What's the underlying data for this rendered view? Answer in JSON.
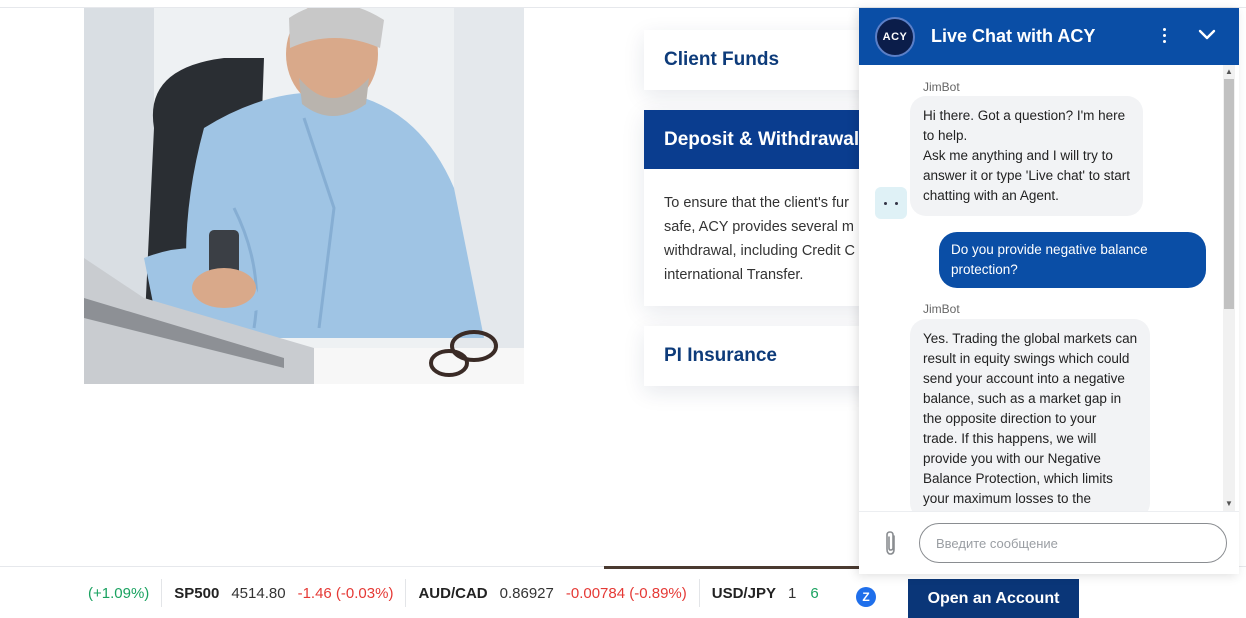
{
  "accordion": {
    "items": [
      {
        "title": "Client Funds"
      },
      {
        "title": "Deposit & Withdrawal",
        "body_lines": [
          "To ensure that the client's fur",
          "safe, ACY provides several m",
          "withdrawal, including Credit C",
          "international Transfer."
        ]
      },
      {
        "title": "PI Insurance"
      }
    ]
  },
  "chat": {
    "logo_text": "ACY",
    "title": "Live Chat with ACY",
    "messages": [
      {
        "sender": "JimBot",
        "lines": [
          "Hi there. Got a question? I'm here",
          "to help.",
          "Ask me anything and I will try to",
          "answer it or type 'Live chat' to start",
          "chatting with an Agent."
        ]
      },
      {
        "sender": "user",
        "lines": [
          "Do you provide negative balance",
          "protection?"
        ]
      },
      {
        "sender": "JimBot",
        "lines": [
          "Yes. Trading the global markets can",
          "result in equity swings which could",
          "send your account into a negative",
          "balance, such as a market gap in",
          "the opposite direction to your",
          "trade. If this happens, we will",
          "provide you with our Negative",
          "Balance Protection, which limits",
          "your maximum losses to the"
        ]
      }
    ],
    "input_placeholder": "Введите сообщение",
    "scroll_up": "▲",
    "scroll_down": "▼"
  },
  "ticker": {
    "lead_change": "(+1.09%)",
    "items": [
      {
        "symbol": "SP500",
        "price": "4514.80",
        "change": "-1.46 (-0.03%)",
        "direction": "down"
      },
      {
        "symbol": "AUD/CAD",
        "price": "0.86927",
        "change": "-0.00784 (-0.89%)",
        "direction": "down"
      },
      {
        "symbol": "USD/JPY",
        "price": "1",
        "change": "6",
        "direction": "up"
      }
    ],
    "badge_text": "Z",
    "open_account_label": "Open an Account"
  },
  "colors": {
    "brand_blue": "#0a4ea6",
    "navy": "#0a3678",
    "up": "#1aa260",
    "down": "#e53935"
  }
}
